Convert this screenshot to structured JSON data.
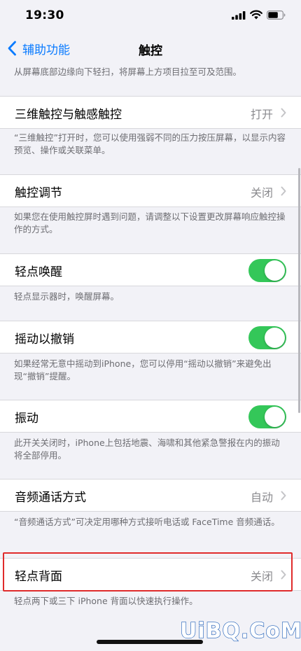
{
  "status_bar": {
    "time": "19:30"
  },
  "nav": {
    "back_label": "辅助功能",
    "title": "触控"
  },
  "sections": {
    "top_footer": "从屏幕底部边缘向下轻扫，将屏幕上方项目拉至可及范围。",
    "touch_3d": {
      "label": "三维触控与触感触控",
      "value": "打开",
      "footer": "“三维触控”打开时，您可以使用强弱不同的压力按压屏幕，以显示内容预览、操作或关联菜单。"
    },
    "touch_accommodations": {
      "label": "触控调节",
      "value": "关闭",
      "footer": "如果您在使用触控屏时遇到问题，请调整以下设置更改屏幕响应触控操作的方式。"
    },
    "tap_to_wake": {
      "label": "轻点唤醒",
      "enabled": true,
      "footer": "轻点显示器时，唤醒屏幕。"
    },
    "shake_to_undo": {
      "label": "摇动以撤销",
      "enabled": true,
      "footer": "如果经常无意中摇动到iPhone，您可以停用“摇动以撤销”来避免出现“撤销”提醒。"
    },
    "vibration": {
      "label": "振动",
      "enabled": true,
      "footer": "此开关关闭时，iPhone上包括地震、海啸和其他紧急警报在内的振动将全部停用。"
    },
    "call_audio_routing": {
      "label": "音频通话方式",
      "value": "自动",
      "footer": "“音频通话方式”可决定用哪种方式接听电话或 FaceTime 音频通话。"
    },
    "back_tap": {
      "label": "轻点背面",
      "value": "关闭",
      "footer": "轻点两下或三下 iPhone 背面以快速执行操作。"
    }
  },
  "colors": {
    "accent": "#0a7bff",
    "toggle_on": "#34c759",
    "highlight": "#e02b2b",
    "background": "#f2f2f7"
  },
  "watermark": "UiBQ.CoM"
}
